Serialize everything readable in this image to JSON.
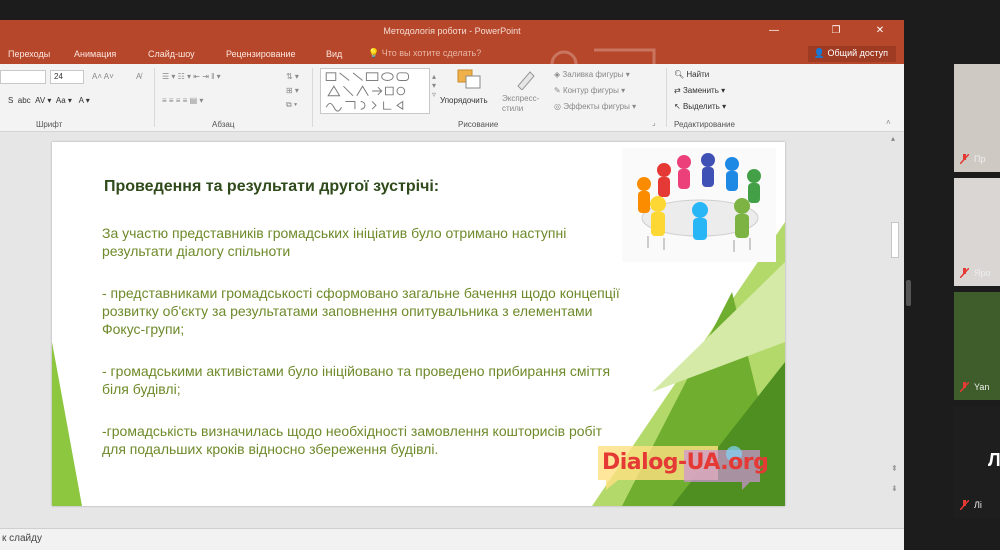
{
  "window": {
    "title": "Методологія роботи - PowerPoint",
    "min": "—",
    "restore": "❐",
    "close": "✕"
  },
  "tabs": [
    "Переходы",
    "Анимация",
    "Слайд-шоу",
    "Рецензирование",
    "Вид"
  ],
  "search_placeholder": "Что вы хотите сделать?",
  "share_label": "Общий доступ",
  "ribbon": {
    "font_size": "24",
    "groups": {
      "font": "Шрифт",
      "paragraph": "Абзац",
      "drawing": "Рисование",
      "editing": "Редактирование"
    },
    "arrange": "Упорядочить",
    "quick_styles": "Экспресс-стили",
    "shape_fill": "Заливка фигуры",
    "shape_outline": "Контур фигуры",
    "shape_effects": "Эффекты фигуры",
    "find": "Найти",
    "replace": "Заменить",
    "select": "Выделить"
  },
  "slide": {
    "title": "Проведення та результати другої зустрічі:",
    "para1": "За участю представників громадських ініціатив було отримано наступні результати діалогу спільноти",
    "para2": "- представниками громадськості сформовано загальне бачення щодо концепції розвитку об'єкту за результатами заповнення опитувальника з елементами Фокус-групи;",
    "para3": "- громадськими активістами було ініційовано та проведено прибирання сміття біля будівлі;",
    "para4": "-громадськість визначилась щодо необхідності замовлення кошторисів робіт для подальших кроків відносно збереження будівлі.",
    "logo_text": "Dialog-UA.org"
  },
  "notes_label": "к слайду",
  "participants": [
    {
      "name": "Пр",
      "bg": "#cfc9c4"
    },
    {
      "name": "Яро",
      "bg": "#d9d6d3"
    },
    {
      "name": "Yan",
      "bg": "#3f5d2a"
    },
    {
      "name": "Лі",
      "bg": "#1e1e1e",
      "initial": "Л"
    }
  ],
  "colors": {
    "ppt_accent": "#b7472a",
    "slide_green": "#8dc63f",
    "title_text": "#2f4a1b",
    "body_text": "#6e8a2a"
  }
}
